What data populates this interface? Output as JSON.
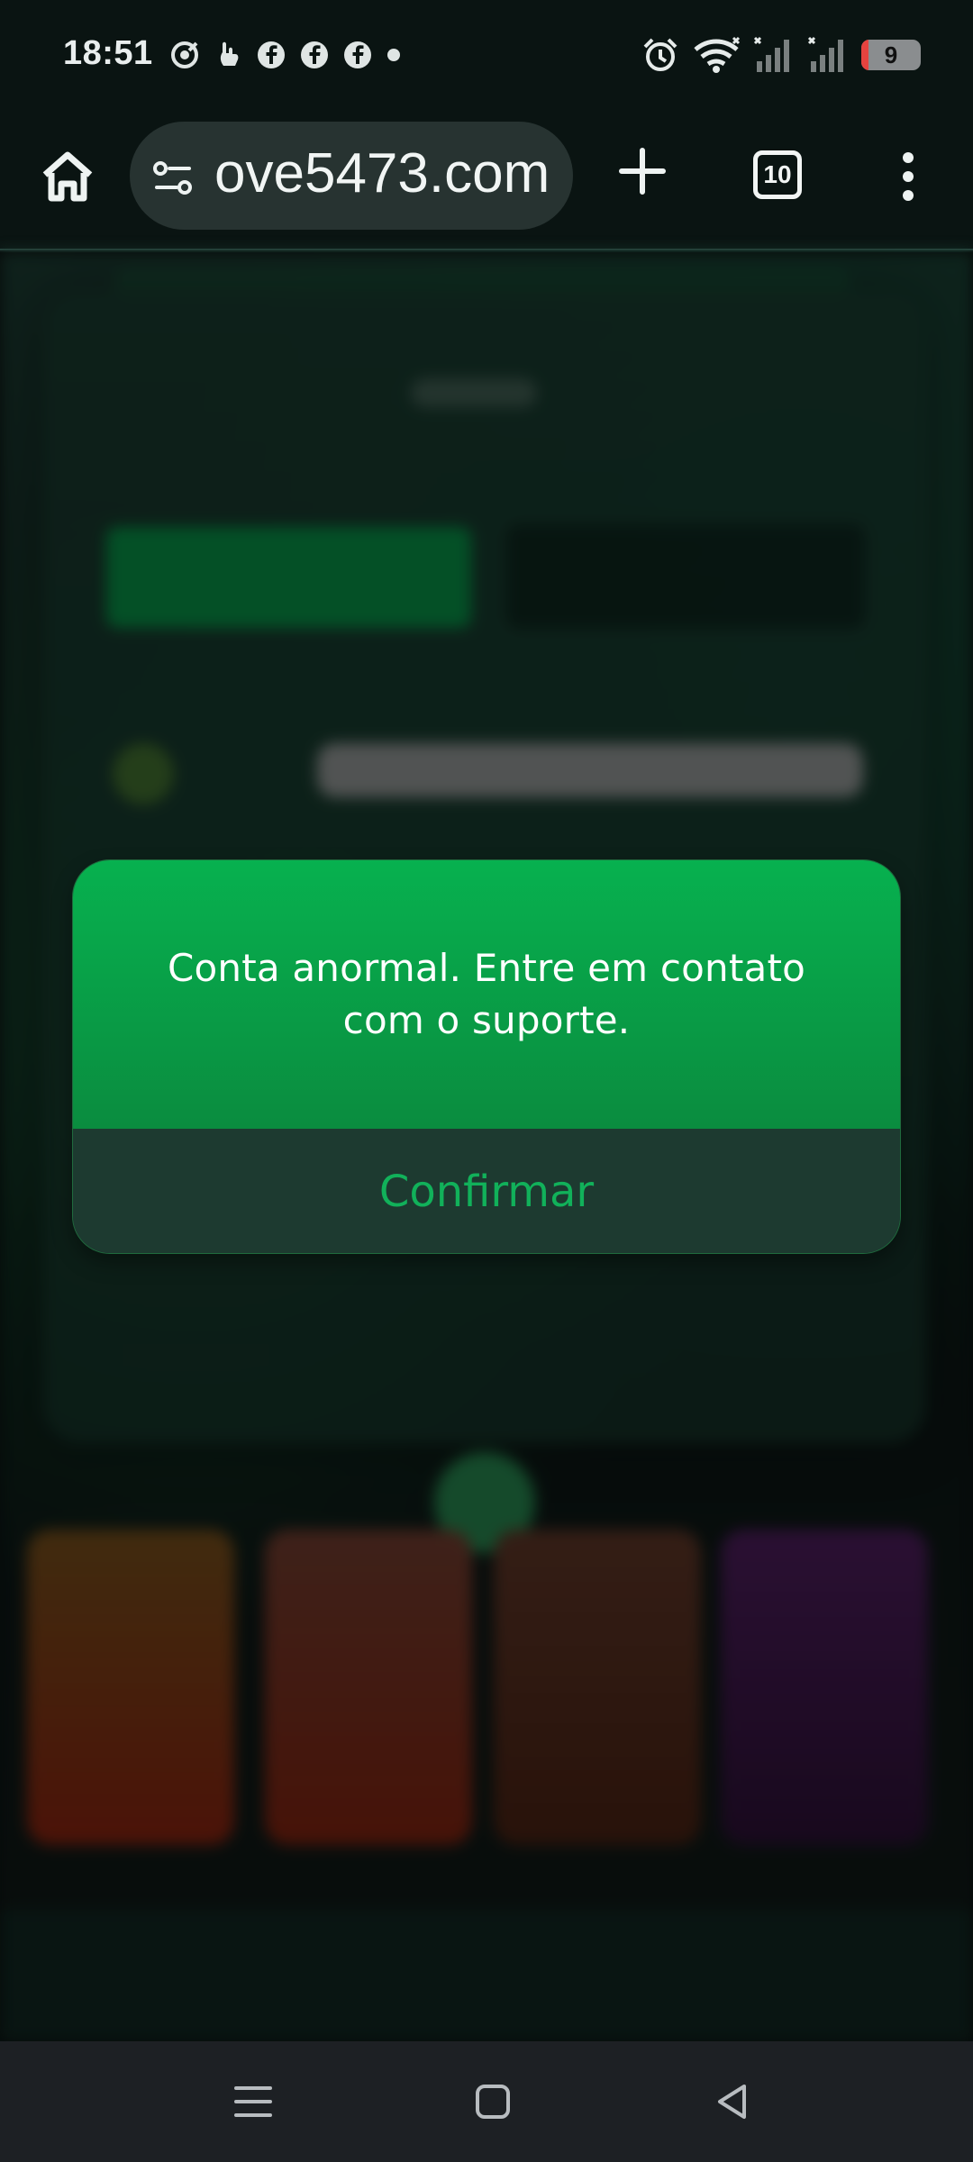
{
  "status_bar": {
    "time": "18:51",
    "battery": "9"
  },
  "browser": {
    "url_text": "ove5473.com",
    "tab_count": "10"
  },
  "dialog": {
    "message": "Conta anormal. Entre em contato com o suporte.",
    "confirm_label": "Confirmar"
  },
  "icons": {
    "left_status": [
      "target-icon",
      "hand-icon",
      "facebook-icon",
      "facebook-icon",
      "facebook-icon",
      "dot-icon"
    ],
    "right_status": [
      "alarm-icon",
      "wifi-icon",
      "signal-icon",
      "signal-icon",
      "battery-icon"
    ]
  },
  "colors": {
    "dialog_green": "#08a64b",
    "confirm_green": "#11b15a"
  }
}
